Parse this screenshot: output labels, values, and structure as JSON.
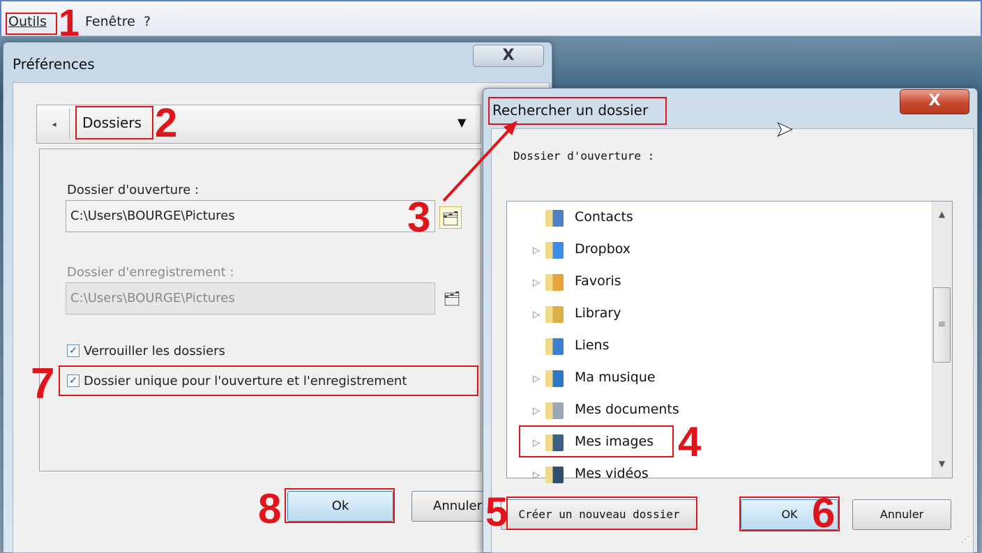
{
  "menubar": {
    "items": [
      "Outils",
      "Fenêtre",
      "?"
    ]
  },
  "preferences": {
    "title": "Préférences",
    "close_label": "X",
    "nav": {
      "back_label": "◂",
      "section": "Dossiers",
      "caret": "▼"
    },
    "open_folder": {
      "label": "Dossier d'ouverture :",
      "value": "C:\\Users\\BOURGE\\Pictures"
    },
    "save_folder": {
      "label": "Dossier d'enregistrement :",
      "value": "C:\\Users\\BOURGE\\Pictures"
    },
    "checkboxes": [
      {
        "label": "Verrouiller les dossiers",
        "checked": true
      },
      {
        "label": "Dossier unique pour l'ouverture et l'enregistrement",
        "checked": true
      }
    ],
    "ok_label": "Ok",
    "cancel_label": "Annuler"
  },
  "browse_dialog": {
    "title": "Rechercher un dossier",
    "close_label": "X",
    "caption": "Dossier d'ouverture :",
    "tree": [
      {
        "label": "Contacts",
        "expandable": false,
        "color": "#4f7fc4"
      },
      {
        "label": "Dropbox",
        "expandable": true,
        "color": "#3a8ee8"
      },
      {
        "label": "Favoris",
        "expandable": true,
        "color": "#e8a33a"
      },
      {
        "label": "Library",
        "expandable": true,
        "color": "#d9b04a"
      },
      {
        "label": "Liens",
        "expandable": false,
        "color": "#3a7fd0"
      },
      {
        "label": "Ma musique",
        "expandable": true,
        "color": "#2f78c8"
      },
      {
        "label": "Mes documents",
        "expandable": true,
        "color": "#9aa8b6"
      },
      {
        "label": "Mes images",
        "expandable": true,
        "color": "#3c5f86"
      },
      {
        "label": "Mes vidéos",
        "expandable": true,
        "color": "#30506f"
      }
    ],
    "new_folder_label": "Créer un nouveau dossier",
    "ok_label": "OK",
    "cancel_label": "Annuler"
  },
  "annotations": [
    "1",
    "2",
    "3",
    "4",
    "5",
    "6",
    "7",
    "8"
  ],
  "colors": {
    "annotation": "#e0141b",
    "title_bar": "#cddcea",
    "close_red": "#c9492f"
  }
}
